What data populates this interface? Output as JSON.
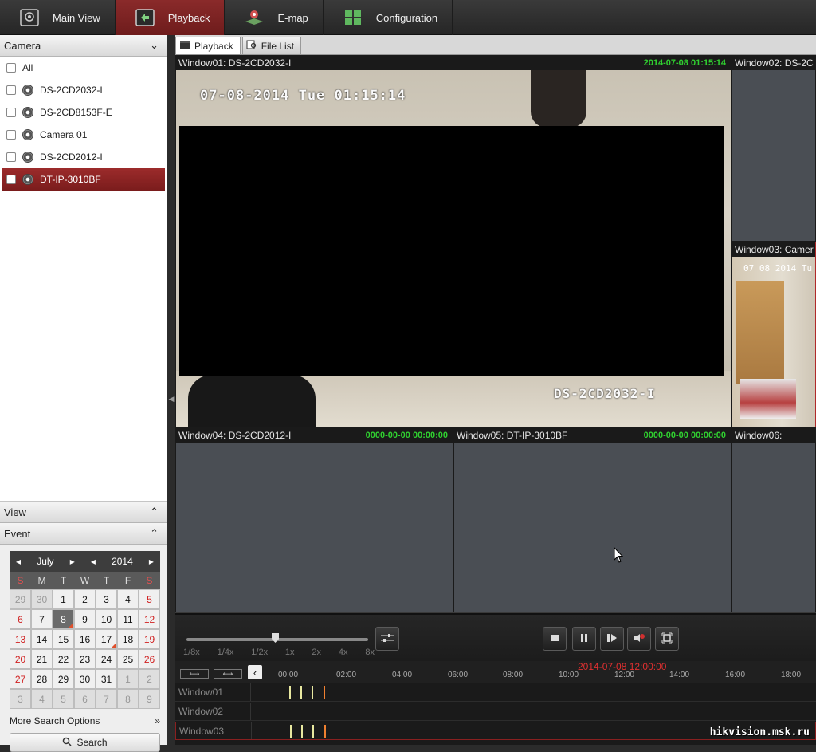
{
  "nav": {
    "tabs": [
      {
        "label": "Main View",
        "icon": "camera-view-icon"
      },
      {
        "label": "Playback",
        "icon": "playback-icon"
      },
      {
        "label": "E-map",
        "icon": "emap-icon"
      },
      {
        "label": "Configuration",
        "icon": "configuration-grid-icon"
      }
    ],
    "active": "Playback"
  },
  "left": {
    "camera_header": "Camera",
    "cameras": [
      "All",
      "DS-2CD2032-I",
      "DS-2CD8153F-E",
      "Camera 01",
      "DS-2CD2012-I",
      "DT-IP-3010BF"
    ],
    "selected_camera": "DT-IP-3010BF",
    "view_header": "View",
    "event_header": "Event",
    "more_search": "More Search Options",
    "search_button": "Search"
  },
  "calendar": {
    "month": "July",
    "year": "2014",
    "weekdays": [
      "S",
      "M",
      "T",
      "W",
      "T",
      "F",
      "S"
    ],
    "weeks": [
      [
        "29",
        "30",
        "1",
        "2",
        "3",
        "4",
        "5"
      ],
      [
        "6",
        "7",
        "8",
        "9",
        "10",
        "11",
        "12"
      ],
      [
        "13",
        "14",
        "15",
        "16",
        "17",
        "18",
        "19"
      ],
      [
        "20",
        "21",
        "22",
        "23",
        "24",
        "25",
        "26"
      ],
      [
        "27",
        "28",
        "29",
        "30",
        "31",
        "1",
        "2"
      ],
      [
        "3",
        "4",
        "5",
        "6",
        "7",
        "8",
        "9"
      ]
    ],
    "selected_day": "8",
    "marked_days": [
      "8",
      "17"
    ]
  },
  "subtabs": [
    "Playback",
    "File List"
  ],
  "windows": {
    "w1": {
      "title": "Window01: DS-2CD2032-I",
      "time": "2014-07-08 01:15:14",
      "osd_date": "07-08-2014 Tue 01:15:14",
      "osd_name": "DS-2CD2032-I"
    },
    "w2": {
      "title": "Window02: DS-2C",
      "time": ""
    },
    "w3": {
      "title": "Window03: Camer",
      "time": "",
      "osd": "07 08 2014 Tu"
    },
    "w4": {
      "title": "Window04: DS-2CD2012-I",
      "time": "0000-00-00 00:00:00"
    },
    "w5": {
      "title": "Window05: DT-IP-3010BF",
      "time": "0000-00-00 00:00:00"
    },
    "w6": {
      "title": "Window06:",
      "time": ""
    }
  },
  "controls": {
    "speed_labels": [
      "1/8x",
      "1/4x",
      "1/2x",
      "1x",
      "2x",
      "4x",
      "8x"
    ],
    "speed_value": "1x"
  },
  "timeline": {
    "current_time": "2014-07-08 12:00:00",
    "ticks": [
      "00:00",
      "02:00",
      "04:00",
      "06:00",
      "08:00",
      "10:00",
      "12:00",
      "14:00",
      "16:00",
      "18:00"
    ],
    "rows": [
      "Window01",
      "Window02",
      "Window03"
    ]
  },
  "watermark": "hikvision.msk.ru",
  "colors": {
    "accent": "#8a2a2a",
    "osd_time": "#30d030",
    "timeline_current": "#e03030"
  }
}
